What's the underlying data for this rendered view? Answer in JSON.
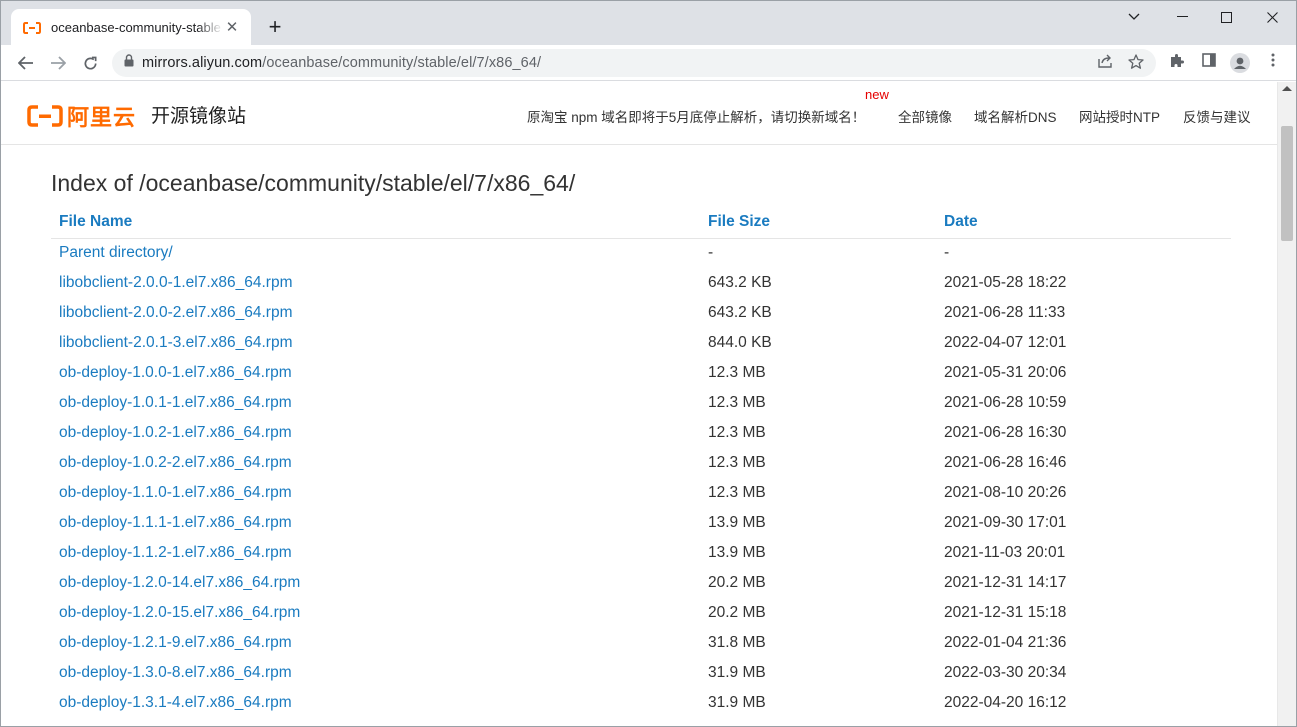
{
  "browser": {
    "tab_title": "oceanbase-community-stable",
    "tab_close": "✕",
    "new_tab": "+",
    "url_host": "mirrors.aliyun.com",
    "url_path": "/oceanbase/community/stable/el/7/x86_64/"
  },
  "header": {
    "logo_text": "阿里云",
    "site_name": "开源镜像站",
    "notice": "原淘宝 npm 域名即将于5月底停止解析，请切换新域名！",
    "new_badge": "new",
    "nav": [
      "全部镜像",
      "域名解析DNS",
      "网站授时NTP",
      "反馈与建议"
    ]
  },
  "listing": {
    "title": "Index of /oceanbase/community/stable/el/7/x86_64/",
    "columns": [
      "File Name",
      "File Size",
      "Date"
    ],
    "rows": [
      {
        "name": "Parent directory/",
        "size": "-",
        "date": "-"
      },
      {
        "name": "libobclient-2.0.0-1.el7.x86_64.rpm",
        "size": "643.2 KB",
        "date": "2021-05-28 18:22"
      },
      {
        "name": "libobclient-2.0.0-2.el7.x86_64.rpm",
        "size": "643.2 KB",
        "date": "2021-06-28 11:33"
      },
      {
        "name": "libobclient-2.0.1-3.el7.x86_64.rpm",
        "size": "844.0 KB",
        "date": "2022-04-07 12:01"
      },
      {
        "name": "ob-deploy-1.0.0-1.el7.x86_64.rpm",
        "size": "12.3 MB",
        "date": "2021-05-31 20:06"
      },
      {
        "name": "ob-deploy-1.0.1-1.el7.x86_64.rpm",
        "size": "12.3 MB",
        "date": "2021-06-28 10:59"
      },
      {
        "name": "ob-deploy-1.0.2-1.el7.x86_64.rpm",
        "size": "12.3 MB",
        "date": "2021-06-28 16:30"
      },
      {
        "name": "ob-deploy-1.0.2-2.el7.x86_64.rpm",
        "size": "12.3 MB",
        "date": "2021-06-28 16:46"
      },
      {
        "name": "ob-deploy-1.1.0-1.el7.x86_64.rpm",
        "size": "12.3 MB",
        "date": "2021-08-10 20:26"
      },
      {
        "name": "ob-deploy-1.1.1-1.el7.x86_64.rpm",
        "size": "13.9 MB",
        "date": "2021-09-30 17:01"
      },
      {
        "name": "ob-deploy-1.1.2-1.el7.x86_64.rpm",
        "size": "13.9 MB",
        "date": "2021-11-03 20:01"
      },
      {
        "name": "ob-deploy-1.2.0-14.el7.x86_64.rpm",
        "size": "20.2 MB",
        "date": "2021-12-31 14:17"
      },
      {
        "name": "ob-deploy-1.2.0-15.el7.x86_64.rpm",
        "size": "20.2 MB",
        "date": "2021-12-31 15:18"
      },
      {
        "name": "ob-deploy-1.2.1-9.el7.x86_64.rpm",
        "size": "31.8 MB",
        "date": "2022-01-04 21:36"
      },
      {
        "name": "ob-deploy-1.3.0-8.el7.x86_64.rpm",
        "size": "31.9 MB",
        "date": "2022-03-30 20:34"
      },
      {
        "name": "ob-deploy-1.3.1-4.el7.x86_64.rpm",
        "size": "31.9 MB",
        "date": "2022-04-20 16:12"
      }
    ]
  },
  "icons": {
    "back": "back-arrow-icon",
    "forward": "forward-arrow-icon",
    "reload": "reload-icon",
    "lock": "lock-icon",
    "share": "share-icon",
    "star": "star-icon",
    "extensions": "puzzle-icon",
    "sidepanel": "side-panel-icon",
    "profile": "profile-icon",
    "menu": "kebab-menu-icon"
  },
  "colors": {
    "brand": "#ff6a00",
    "link": "#1a7bc0",
    "new_badge": "#e50000"
  }
}
